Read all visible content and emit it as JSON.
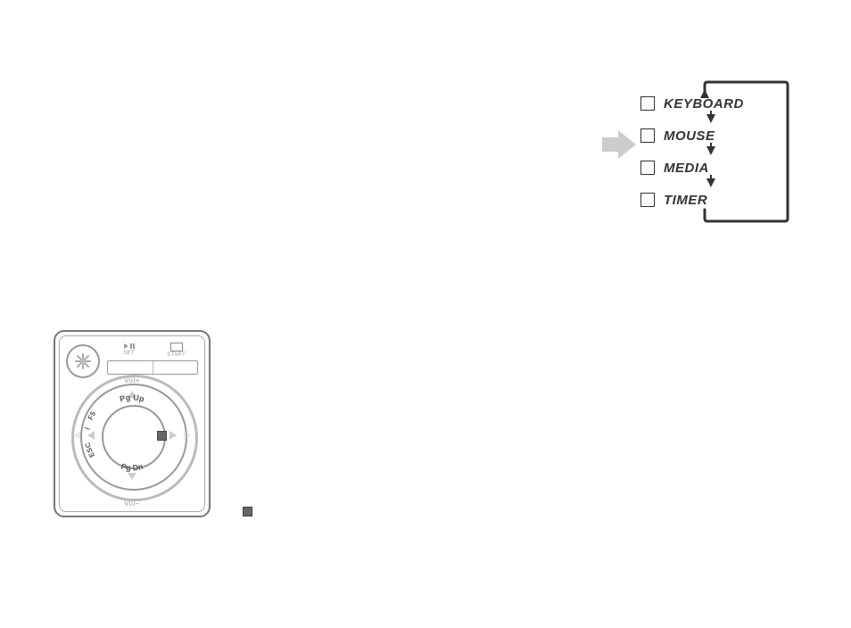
{
  "modes": {
    "items": [
      {
        "label": "KEYBOARD"
      },
      {
        "label": "MOUSE"
      },
      {
        "label": "MEDIA"
      },
      {
        "label": "TIMER"
      }
    ]
  },
  "remote": {
    "leds": {
      "left_icon": "play-pause",
      "left_caption": "SET",
      "right_icon": "stop",
      "right_caption": "START"
    },
    "volume": {
      "up": "Vol+",
      "down": "Vol−"
    },
    "dial": {
      "top": "Pg Up",
      "bottom": "Pg Dn",
      "leftA": "ESC",
      "leftB": "F5"
    }
  }
}
